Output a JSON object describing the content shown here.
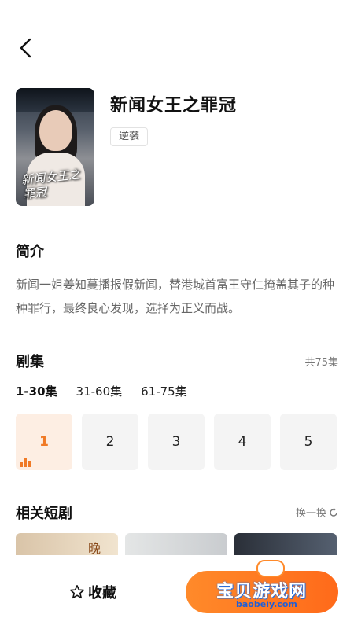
{
  "drama": {
    "title": "新闻女王之罪冠",
    "tag": "逆袭",
    "poster_text": "新闻女王之罪冠"
  },
  "intro": {
    "heading": "简介",
    "text": "新闻一姐姜知蔓播报假新闻，替港城首富王守仁掩盖其子的种种罪行，最终良心发现，选择为正义而战。"
  },
  "episodes": {
    "heading": "剧集",
    "total": "共75集",
    "ranges": [
      "1-30集",
      "31-60集",
      "61-75集"
    ],
    "active_range": 0,
    "items": [
      "1",
      "2",
      "3",
      "4",
      "5"
    ],
    "playing": "1"
  },
  "related": {
    "heading": "相关短剧",
    "refresh_label": "换一换",
    "card1_text": "晚"
  },
  "bottom": {
    "favorite_label": "收藏",
    "watermark": "宝贝游戏网",
    "watermark_url": "baobeiy.com"
  },
  "colors": {
    "accent": "#f07a26",
    "play_button": "#ff7a1f"
  }
}
